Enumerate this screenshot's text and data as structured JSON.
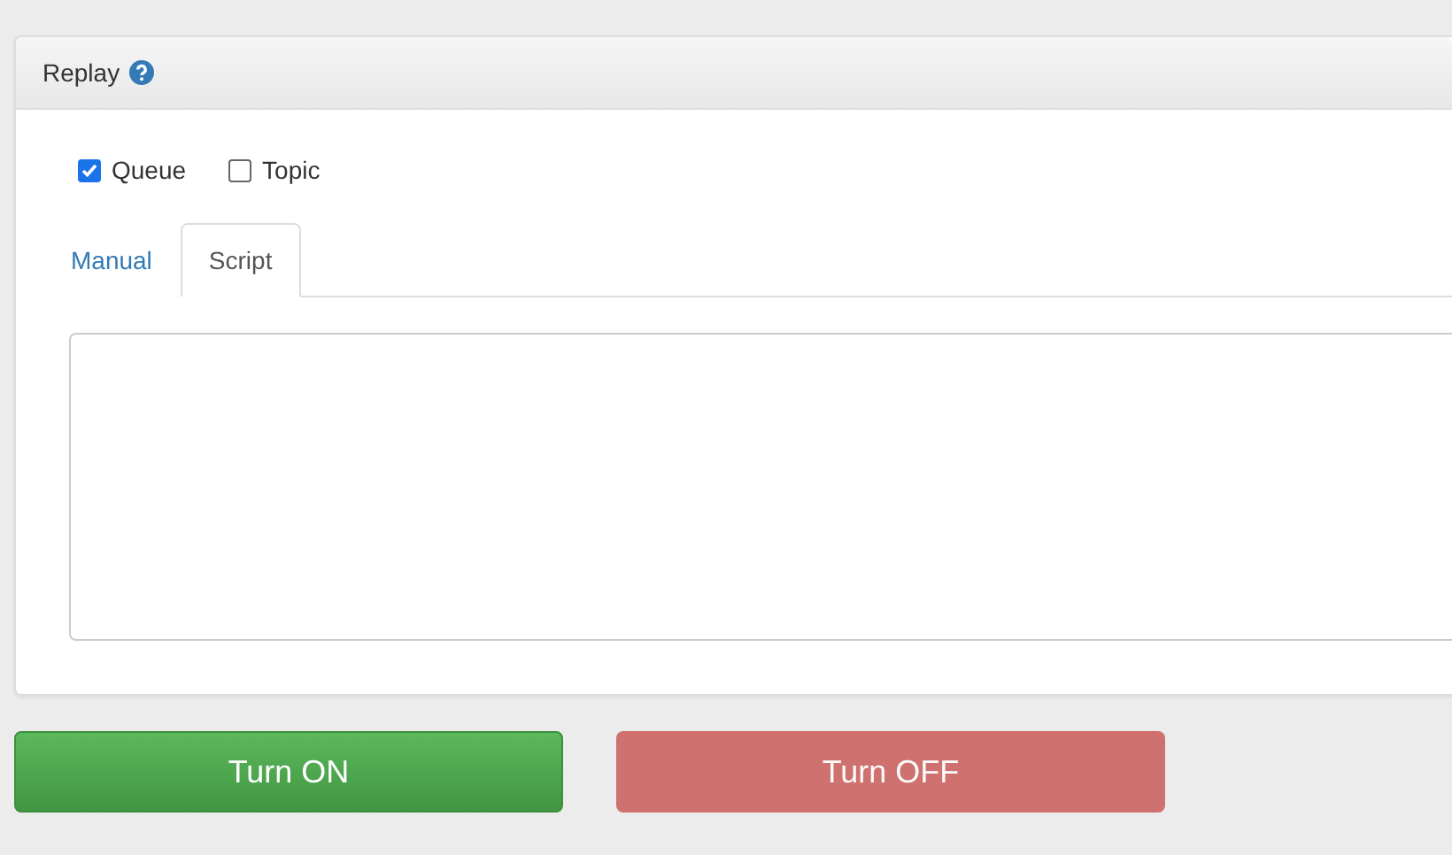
{
  "panel": {
    "title": "Replay"
  },
  "checkboxes": [
    {
      "label": "Queue",
      "checked": true
    },
    {
      "label": "Topic",
      "checked": false
    }
  ],
  "tabs": [
    {
      "label": "Manual",
      "selected": false
    },
    {
      "label": "Script",
      "selected": true
    }
  ],
  "buttons": [
    {
      "label": "Turn ON",
      "kind": "success",
      "disabled": false
    },
    {
      "label": "Turn OFF",
      "kind": "danger",
      "disabled": true
    }
  ]
}
